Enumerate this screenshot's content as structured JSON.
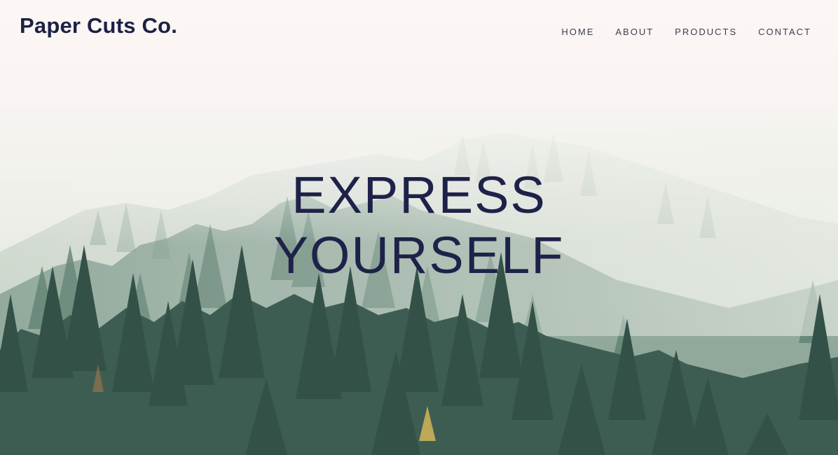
{
  "brand": {
    "name": "Paper Cuts Co."
  },
  "nav": {
    "items": [
      {
        "label": "HOME"
      },
      {
        "label": "ABOUT"
      },
      {
        "label": "PRODUCTS"
      },
      {
        "label": "CONTACT"
      }
    ]
  },
  "hero": {
    "headline_line1": "EXPRESS",
    "headline_line2": "YOURSELF",
    "image": "misty-pine-forest"
  },
  "colors": {
    "brand": "#1c2145",
    "nav_text": "#3c3f4e",
    "sky": "#fbf6f4",
    "forest": "#2f5145"
  }
}
